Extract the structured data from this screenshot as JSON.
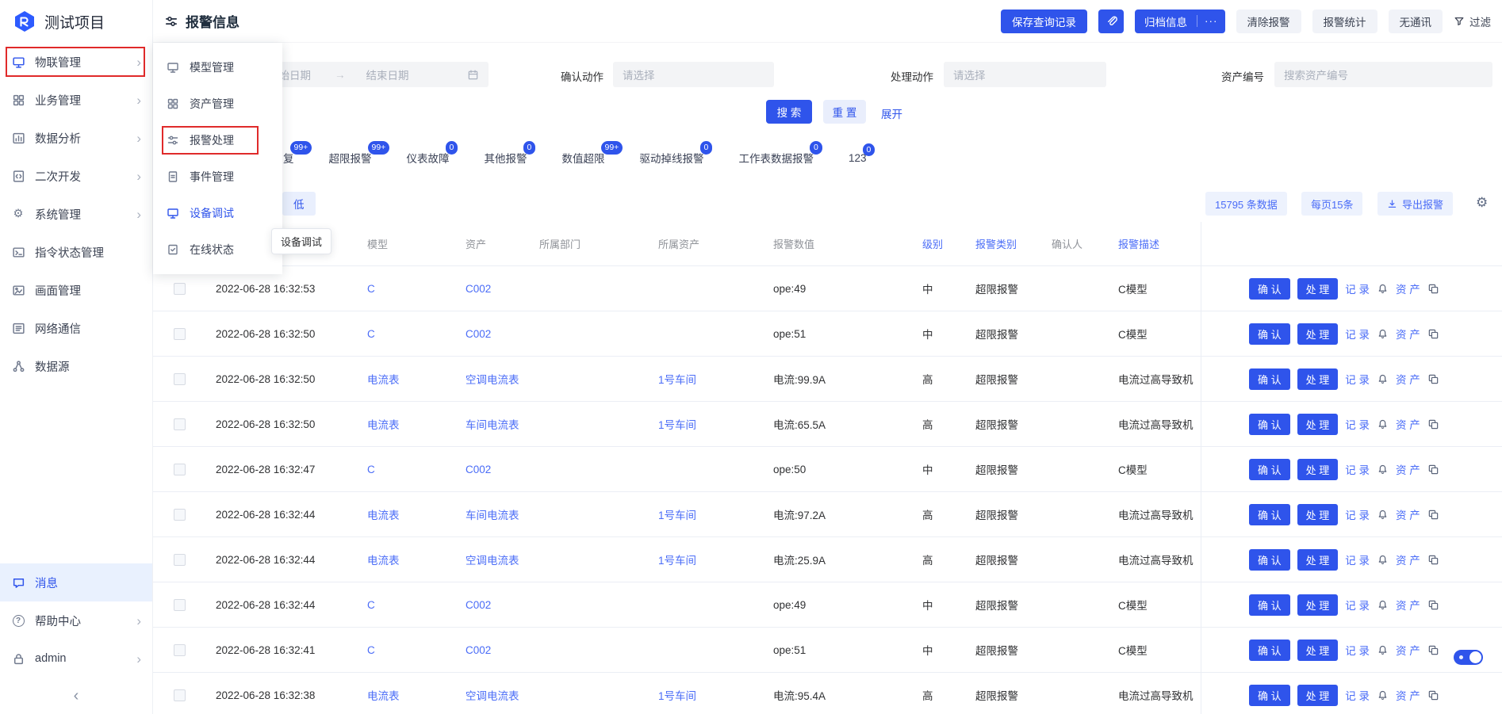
{
  "icons": {
    "gear": "⚙",
    "chevron_right": "›",
    "more": "···",
    "collapse": "‹",
    "range_arrow": "→",
    "question": "?"
  },
  "app": {
    "title": "测试项目"
  },
  "topbar": {
    "page_title": "报警信息",
    "save_query": "保存查询记录",
    "archive": "归档信息",
    "clear_alarm": "清除报警",
    "alarm_stats": "报警统计",
    "no_comm": "无通讯",
    "filter": "过滤"
  },
  "sidebar": {
    "items": [
      "物联管理",
      "业务管理",
      "数据分析",
      "二次开发",
      "系统管理",
      "指令状态管理",
      "画面管理",
      "网络通信",
      "数据源"
    ],
    "bottom": [
      "消息",
      "帮助中心",
      "admin"
    ]
  },
  "submenu": {
    "items": [
      "模型管理",
      "资产管理",
      "报警处理",
      "事件管理",
      "设备调试",
      "在线状态"
    ],
    "tooltip": "设备调试"
  },
  "filters": {
    "start_placeholder": "开始日期",
    "end_placeholder": "结束日期",
    "confirm_label": "确认动作",
    "confirm_placeholder": "请选择",
    "handle_label": "处理动作",
    "handle_placeholder": "请选择",
    "asset_label": "资产编号",
    "asset_placeholder": "搜索资产编号",
    "search": "搜 索",
    "reset": "重 置",
    "expand": "展开"
  },
  "alarm_tabs": [
    {
      "label": "复",
      "badge": "99+"
    },
    {
      "label": "超限报警",
      "badge": "99+"
    },
    {
      "label": "仪表故障",
      "badge": "0"
    },
    {
      "label": "其他报警",
      "badge": "0"
    },
    {
      "label": "数值超限",
      "badge": "99+"
    },
    {
      "label": "驱动掉线报警",
      "badge": "0"
    },
    {
      "label": "工作表数据报警",
      "badge": "0"
    },
    {
      "label": "123",
      "badge": "0"
    }
  ],
  "level_filter": "低",
  "toolbar": {
    "total": "15795 条数据",
    "page_size": "每页15条",
    "export": "导出报警"
  },
  "table": {
    "headers": {
      "time": "",
      "model": "模型",
      "asset": "资产",
      "dept": "所属部门",
      "parent": "所属资产",
      "value": "报警数值",
      "level": "级别",
      "category": "报警类别",
      "confirmer": "确认人",
      "desc": "报警描述"
    },
    "rows": [
      {
        "time": "2022-06-28 16:32:53",
        "model": "C",
        "asset": "C002",
        "dept": "",
        "parent": "",
        "value": "ope:49",
        "level": "中",
        "category": "超限报警",
        "confirmer": "",
        "desc": "C模型"
      },
      {
        "time": "2022-06-28 16:32:50",
        "model": "C",
        "asset": "C002",
        "dept": "",
        "parent": "",
        "value": "ope:51",
        "level": "中",
        "category": "超限报警",
        "confirmer": "",
        "desc": "C模型"
      },
      {
        "time": "2022-06-28 16:32:50",
        "model": "电流表",
        "asset": "空调电流表",
        "dept": "",
        "parent": "1号车间",
        "value": "电流:99.9A",
        "level": "高",
        "category": "超限报警",
        "confirmer": "",
        "desc": "电流过高导致机"
      },
      {
        "time": "2022-06-28 16:32:50",
        "model": "电流表",
        "asset": "车间电流表",
        "dept": "",
        "parent": "1号车间",
        "value": "电流:65.5A",
        "level": "高",
        "category": "超限报警",
        "confirmer": "",
        "desc": "电流过高导致机"
      },
      {
        "time": "2022-06-28 16:32:47",
        "model": "C",
        "asset": "C002",
        "dept": "",
        "parent": "",
        "value": "ope:50",
        "level": "中",
        "category": "超限报警",
        "confirmer": "",
        "desc": "C模型"
      },
      {
        "time": "2022-06-28 16:32:44",
        "model": "电流表",
        "asset": "车间电流表",
        "dept": "",
        "parent": "1号车间",
        "value": "电流:97.2A",
        "level": "高",
        "category": "超限报警",
        "confirmer": "",
        "desc": "电流过高导致机"
      },
      {
        "time": "2022-06-28 16:32:44",
        "model": "电流表",
        "asset": "空调电流表",
        "dept": "",
        "parent": "1号车间",
        "value": "电流:25.9A",
        "level": "高",
        "category": "超限报警",
        "confirmer": "",
        "desc": "电流过高导致机"
      },
      {
        "time": "2022-06-28 16:32:44",
        "model": "C",
        "asset": "C002",
        "dept": "",
        "parent": "",
        "value": "ope:49",
        "level": "中",
        "category": "超限报警",
        "confirmer": "",
        "desc": "C模型"
      },
      {
        "time": "2022-06-28 16:32:41",
        "model": "C",
        "asset": "C002",
        "dept": "",
        "parent": "",
        "value": "ope:51",
        "level": "中",
        "category": "超限报警",
        "confirmer": "",
        "desc": "C模型"
      },
      {
        "time": "2022-06-28 16:32:38",
        "model": "电流表",
        "asset": "空调电流表",
        "dept": "",
        "parent": "1号车间",
        "value": "电流:95.4A",
        "level": "高",
        "category": "超限报警",
        "confirmer": "",
        "desc": "电流过高导致机"
      }
    ]
  },
  "row_actions": {
    "confirm": "确 认",
    "handle": "处 理",
    "record": "记 录",
    "asset": "资 产"
  }
}
